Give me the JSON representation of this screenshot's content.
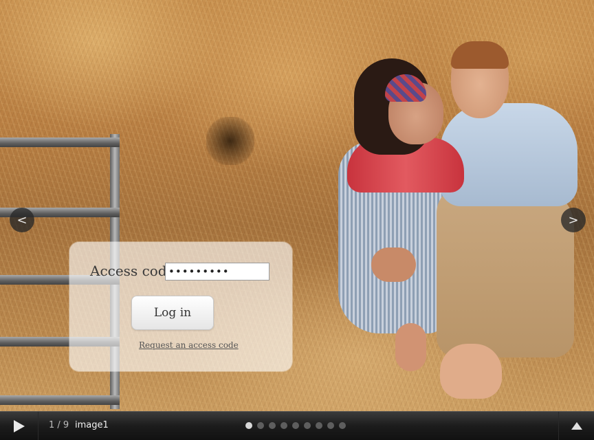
{
  "login": {
    "label": "Access code",
    "input_value": "•••••••••",
    "button_label": "Log in",
    "request_link": "Request an access code"
  },
  "nav": {
    "prev_glyph": "<",
    "next_glyph": ">"
  },
  "bottom_bar": {
    "counter": "1 / 9",
    "image_title": "image1",
    "dot_count": 9,
    "active_dot": 0,
    "play_icon": "play-icon",
    "expand_icon": "triangle-up-icon"
  }
}
